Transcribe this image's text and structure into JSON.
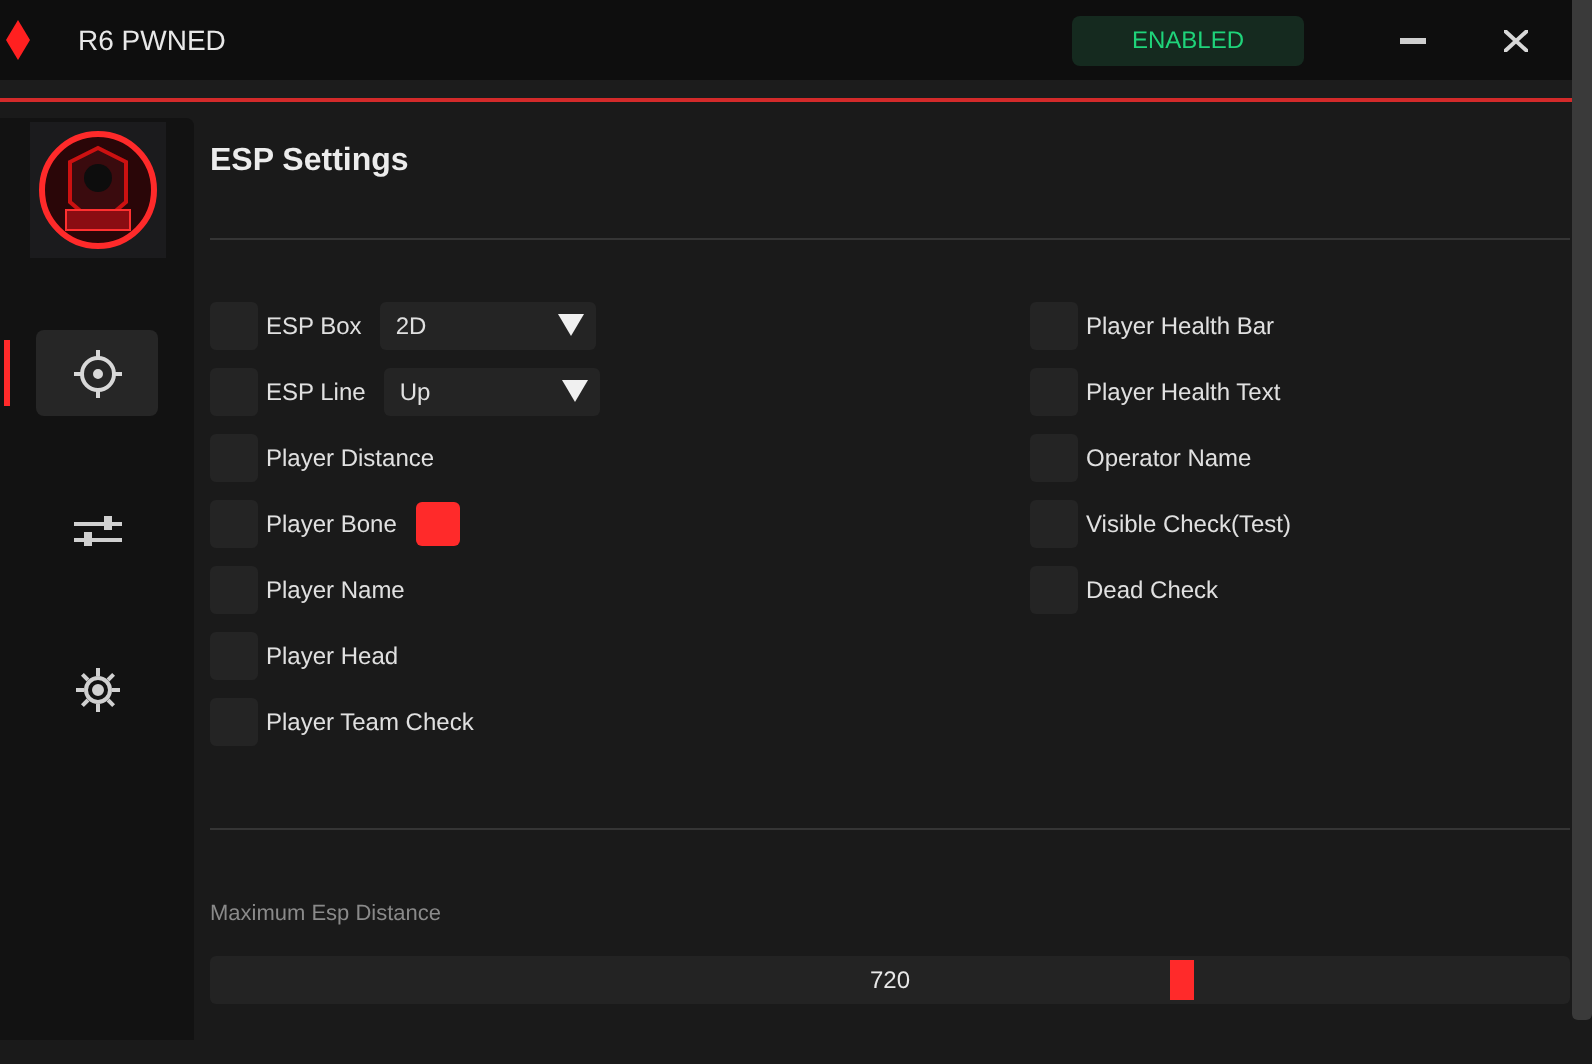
{
  "window": {
    "title": "R6 PWNED",
    "status": "ENABLED"
  },
  "nav": [
    {
      "kind": "crosshair",
      "selected": true
    },
    {
      "kind": "sliders",
      "selected": false
    },
    {
      "kind": "gear",
      "selected": false
    }
  ],
  "section": {
    "title": "ESP Settings"
  },
  "left_options": [
    {
      "kind": "dropdown",
      "label": "ESP Box",
      "checked": false,
      "value": "2D"
    },
    {
      "kind": "dropdown",
      "label": "ESP Line",
      "checked": false,
      "value": "Up"
    },
    {
      "kind": "plain",
      "label": "Player Distance",
      "checked": false
    },
    {
      "kind": "swatch",
      "label": "Player Bone",
      "checked": false,
      "color": "#ff2a2a"
    },
    {
      "kind": "plain",
      "label": "Player Name",
      "checked": false
    },
    {
      "kind": "plain",
      "label": "Player Head",
      "checked": false
    },
    {
      "kind": "plain",
      "label": "Player Team Check",
      "checked": false
    }
  ],
  "right_options": [
    {
      "kind": "plain",
      "label": "Player Health Bar",
      "checked": false
    },
    {
      "kind": "plain",
      "label": "Player Health Text",
      "checked": false
    },
    {
      "kind": "plain",
      "label": "Operator Name",
      "checked": false
    },
    {
      "kind": "plain",
      "label": "Visible Check(Test)",
      "checked": false
    },
    {
      "kind": "plain",
      "label": "Dead Check",
      "checked": false
    }
  ],
  "distance": {
    "label": "Maximum Esp Distance",
    "reading": "720",
    "level": 0.715
  }
}
